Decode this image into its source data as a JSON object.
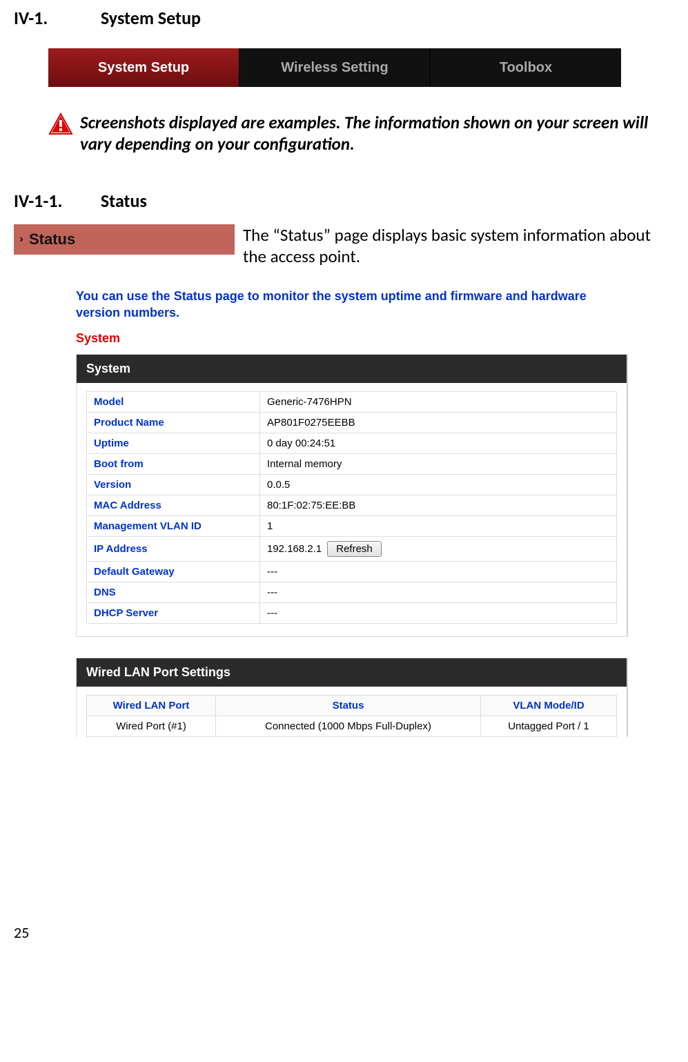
{
  "headings": {
    "main_num": "IV-1.",
    "main_title": "System Setup",
    "sub_num": "IV-1-1.",
    "sub_title": "Status"
  },
  "nav": {
    "system_setup": "System Setup",
    "wireless_setting": "Wireless Setting",
    "toolbox": "Toolbox"
  },
  "warning": "Screenshots displayed are examples. The information shown on your screen will vary depending on your configuration.",
  "status_badge": "Status",
  "status_desc": "The “Status” page displays basic system information about the access point.",
  "screenshot": {
    "intro": "You can use the Status page to monitor the system uptime and firmware and hardware version numbers.",
    "system_label": "System",
    "panel1_title": "System",
    "rows": [
      {
        "k": "Model",
        "v": "Generic-7476HPN"
      },
      {
        "k": "Product Name",
        "v": "AP801F0275EEBB"
      },
      {
        "k": "Uptime",
        "v": " 0 day 00:24:51"
      },
      {
        "k": "Boot from",
        "v": "Internal memory"
      },
      {
        "k": "Version",
        "v": "0.0.5"
      },
      {
        "k": "MAC Address",
        "v": "80:1F:02:75:EE:BB"
      },
      {
        "k": "Management VLAN ID",
        "v": "1"
      },
      {
        "k": "IP Address",
        "v": "192.168.2.1",
        "refresh": true
      },
      {
        "k": "Default Gateway",
        "v": "---"
      },
      {
        "k": "DNS",
        "v": "---"
      },
      {
        "k": "DHCP Server",
        "v": "---"
      }
    ],
    "refresh_label": "Refresh",
    "panel2_title": "Wired LAN Port Settings",
    "lan_headers": {
      "port": "Wired LAN Port",
      "status": "Status",
      "vlan": "VLAN Mode/ID"
    },
    "lan_row": {
      "port": "Wired Port (#1)",
      "status": "Connected (1000 Mbps Full-Duplex)",
      "vlan": "Untagged Port  /   1"
    }
  },
  "page_number": "25"
}
